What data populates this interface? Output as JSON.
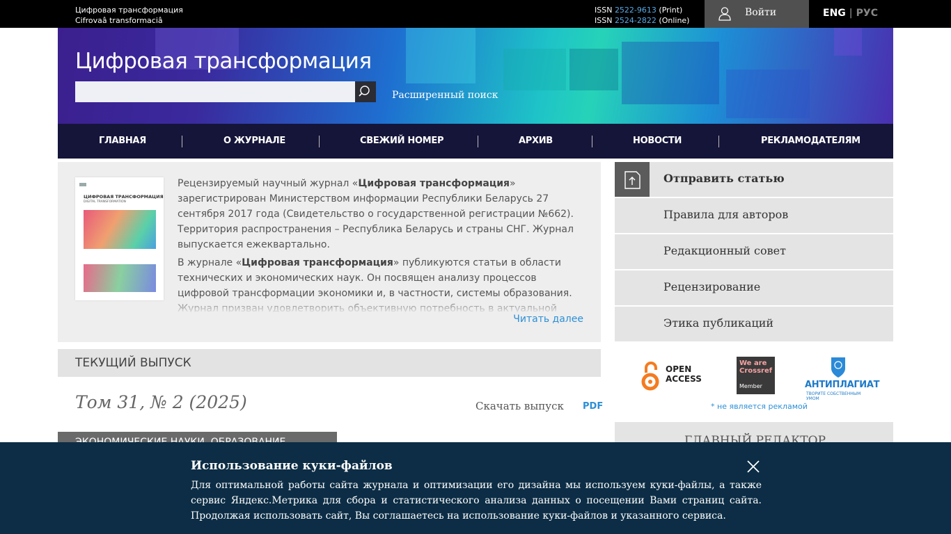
{
  "topbar": {
    "site_title_ru": "Цифровая трансформация",
    "site_title_lat": "Cifrovaâ transformaciâ",
    "issn_print_prefix": "ISSN",
    "issn_print_num": "2522-9613",
    "issn_print_suffix": "(Print)",
    "issn_online_prefix": "ISSN",
    "issn_online_num": "2524-2822",
    "issn_online_suffix": "(Online)",
    "login_label": "Войти",
    "lang_active": "ENG",
    "lang_sep": "|",
    "lang_inactive": "РУС"
  },
  "banner": {
    "journal_title": "Цифровая трансформация",
    "search_value": "",
    "advanced_search": "Расширенный поиск"
  },
  "nav": {
    "items": [
      "ГЛАВНАЯ",
      "О ЖУРНАЛЕ",
      "СВЕЖИЙ НОМЕР",
      "АРХИВ",
      "НОВОСТИ",
      "РЕКЛАМОДАТЕЛЯМ"
    ]
  },
  "about": {
    "p1_pre": "Рецензируемый научный журнал «",
    "p1_bold": "Цифровая трансформация",
    "p1_post": "» зарегистрирован Министерством информации Республики Беларусь 27 сентября 2017 года (Свидетельство о государственной регистрации №662). Территория распространения – Республика Беларусь и страны СНГ. Журнал выпускается ежеквартально.",
    "p2_pre": "В журнале «",
    "p2_bold": "Цифровая трансформация",
    "p2_post": "» публикуются статьи в области технических и экономических наук. Он посвящен анализу процессов цифровой трансформации экономики и, в частности, системы образования. Журнал призван удовлетворить объективную потребность в актуальной",
    "read_more": "Читать далее",
    "cover_title": "ЦИФРОВАЯ ТРАНСФОРМАЦИЯ",
    "cover_subtitle": "DIGITAL TRANSFORMATION"
  },
  "current_issue": {
    "heading": "ТЕКУЩИЙ ВЫПУСК",
    "volume": "Том 31, № 2 (2025)",
    "download_label": "Скачать выпуск",
    "pdf_label": "PDF",
    "section_tag": "ЭКОНОМИЧЕСКИЕ НАУКИ. ОБРАЗОВАНИЕ"
  },
  "sidebar": {
    "items": [
      "Отправить статью",
      "Правила для авторов",
      "Редакционный совет",
      "Рецензирование",
      "Этика публикаций"
    ],
    "open_access_line1": "OPEN",
    "open_access_line2": "ACCESS",
    "crossref_line1": "We are",
    "crossref_line2": "Crossref",
    "crossref_member": "Member",
    "antiplagiat_name": "АНТИПЛАГИАТ",
    "antiplagiat_tagline": "ТВОРИТЕ СОБСТВЕННЫМ УМОМ",
    "not_ad": "* не является рекламой",
    "editor_heading": "ГЛАВНЫЙ РЕДАКТОР"
  },
  "cookie": {
    "title": "Использование куки-файлов",
    "body": "Для оптимальной работы сайта журнала и оптимизации его дизайна мы используем куки-файлы, а также сервис Яндекс.Метрика для сбора и статистического анализа данных о посещении Вами страниц сайта. Продолжая использовать сайт, Вы соглашаетесь на использование куки-файлов и указанного сервиса."
  },
  "colors": {
    "topbar_bg": "#000000",
    "nav_bg": "#15153a",
    "link_blue": "#2c8fd6",
    "cookie_bg": "#0c2d45"
  }
}
